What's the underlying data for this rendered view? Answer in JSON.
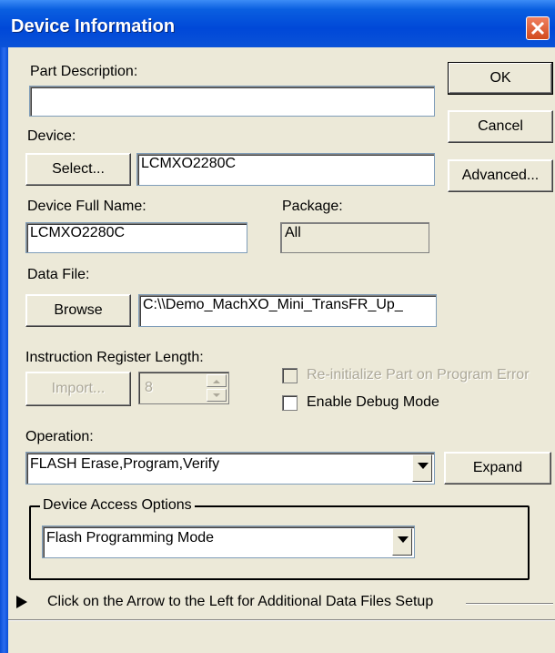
{
  "window": {
    "title": "Device Information"
  },
  "part_description": {
    "label": "Part Description:",
    "value": ""
  },
  "device": {
    "label": "Device:",
    "select_button": "Select...",
    "value": "LCMXO2280C"
  },
  "device_full_name": {
    "label": "Device Full Name:",
    "value": "LCMXO2280C"
  },
  "package": {
    "label": "Package:",
    "value": "All"
  },
  "data_file": {
    "label": "Data File:",
    "browse_button": "Browse",
    "value": "C:\\\\Demo_MachXO_Mini_TransFR_Up_"
  },
  "instruction_register": {
    "label": "Instruction Register Length:",
    "import_button": "Import...",
    "value": "8"
  },
  "options": {
    "reinit_label": "Re-initialize Part on Program Error",
    "reinit_checked": false,
    "debug_label": "Enable Debug Mode",
    "debug_checked": false
  },
  "operation": {
    "label": "Operation:",
    "value": "FLASH Erase,Program,Verify",
    "expand_button": "Expand"
  },
  "device_access": {
    "title": "Device Access Options",
    "value": "Flash Programming Mode"
  },
  "additional_files": {
    "text": "Click on the Arrow to the Left for Additional Data Files Setup"
  },
  "buttons": {
    "ok": "OK",
    "cancel": "Cancel",
    "advanced": "Advanced..."
  },
  "icons": {
    "close": "close-icon",
    "dropdown": "chevron-down-icon",
    "expand": "triangle-right-icon"
  },
  "colors": {
    "titlebar": "#0048d8",
    "dialog_bg": "#ece9d8",
    "close_button": "#d24a1c"
  }
}
